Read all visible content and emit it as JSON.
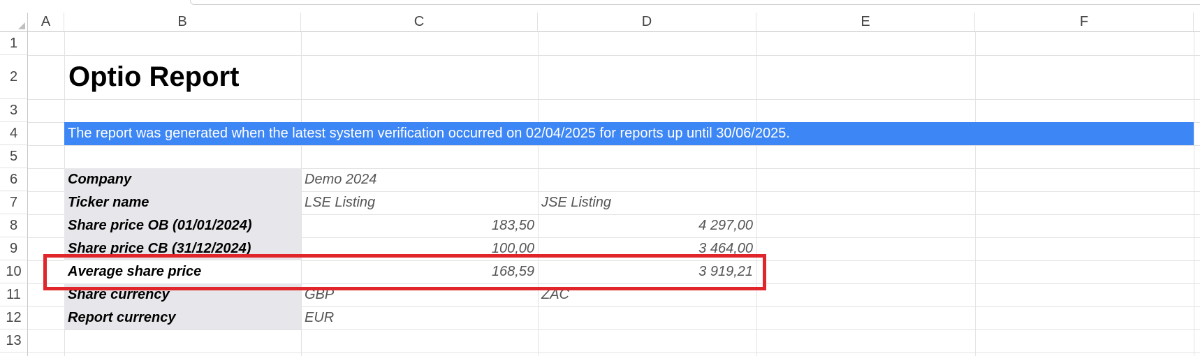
{
  "columns": [
    "A",
    "B",
    "C",
    "D",
    "E",
    "F"
  ],
  "rows": [
    "1",
    "2",
    "3",
    "4",
    "5",
    "6",
    "7",
    "8",
    "9",
    "10",
    "11",
    "12",
    "13"
  ],
  "report": {
    "title": "Optio Report",
    "banner": "The report was generated when the latest system verification occurred on 02/04/2025 for reports up until 30/06/2025."
  },
  "table": [
    {
      "label": "Company",
      "c": "Demo 2024",
      "d": ""
    },
    {
      "label": "Ticker name",
      "c": "LSE Listing",
      "d": "JSE Listing"
    },
    {
      "label": "Share price OB (01/01/2024)",
      "c": "183,50",
      "d": "4 297,00"
    },
    {
      "label": "Share price CB (31/12/2024)",
      "c": "100,00",
      "d": "3 464,00"
    },
    {
      "label": "Average share price",
      "c": "168,59",
      "d": "3 919,21"
    },
    {
      "label": "Share currency",
      "c": "GBP",
      "d": "ZAC"
    },
    {
      "label": "Report currency",
      "c": "EUR",
      "d": ""
    }
  ],
  "colors": {
    "banner": "#3d86f5",
    "highlight": "#e0262b",
    "label_bg": "#e7e6ea"
  }
}
